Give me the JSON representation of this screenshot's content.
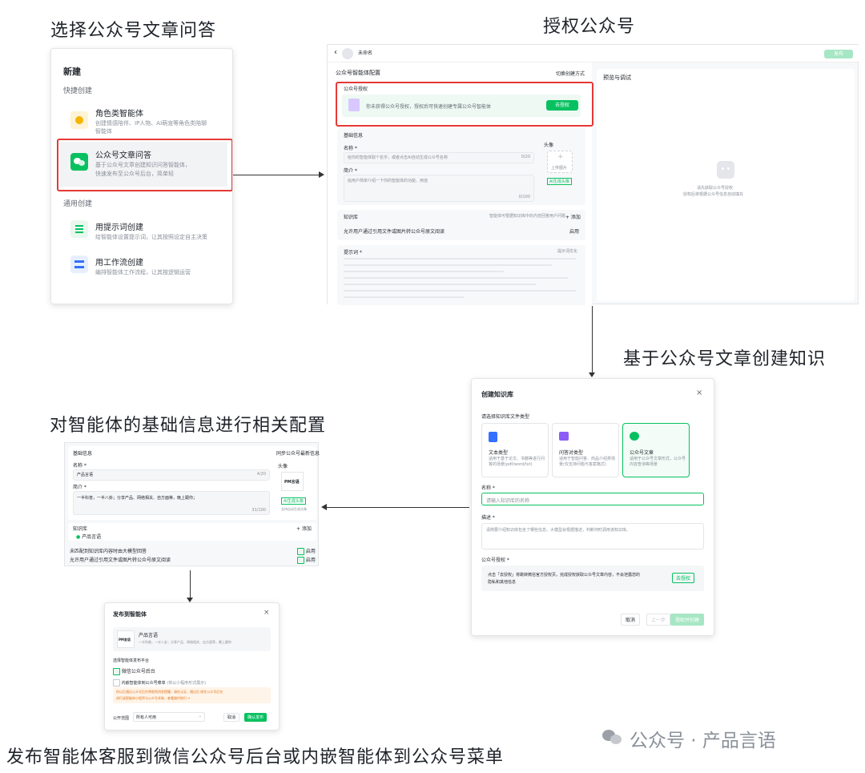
{
  "captions": {
    "step1": "选择公众号文章问答",
    "step2": "授权公众号",
    "step3": "基于公众号文章创建知识",
    "step4": "对智能体的基础信息进行相关配置",
    "step5": "发布智能体客服到微信公众号后台或内嵌智能体到公众号菜单"
  },
  "new_menu": {
    "title": "新建",
    "quick_header": "快捷创建",
    "role": {
      "title": "角色类智能体",
      "desc1": "创建情感陪伴、IP人物、AI萌宠等角色类陪聊",
      "desc2": "智能体"
    },
    "article": {
      "title": "公众号文章问答",
      "desc1": "基于公众号文章创建知识问答智能体，",
      "desc2": "快速发布至公众号后台，简单轻"
    },
    "general_header": "通用创建",
    "prompt": {
      "title": "用提示词创建",
      "desc": "给智能体设置提示词，让其按照设定自主决策"
    },
    "workflow": {
      "title": "用工作流创建",
      "desc": "编排智能体工作流程，让其按逻辑运营"
    }
  },
  "auth_screen": {
    "agent_name": "未命名",
    "publish": "发布",
    "config_title": "公众号智能体配置",
    "switch_mode": "切换创建方式",
    "preview_title": "预览与调试",
    "auth_section": "公众号授权",
    "auth_desc": "你未获得公众号授权，授权后可快速创建专属公众号智能体",
    "auth_btn": "去授权",
    "basic_section": "基础信息",
    "name_label": "名称 *",
    "name_placeholder": "给你的智能体取个名字，或者点击AI自动生成公众号名称",
    "name_count": "0/20",
    "intro_label": "简介 *",
    "intro_placeholder": "给用户简单介绍一下你的智能体的功能、用途",
    "intro_count": "0/100",
    "avatar_label": "头像",
    "avatar_upload": "上传图片",
    "avatar_ai": "AI生成头像",
    "kb_section": "知识库",
    "kb_hint": "智能体可根据知识库中的内容回答用户问题",
    "kb_add": "+ 添加",
    "kb_allow": "允许用户通过引用文件或图片转公众号原文阅读",
    "kb_enable": "启用",
    "prompt_section": "提示词 *",
    "prompt_optimize": "提示词优化",
    "preview_hint1": "请先获取公众号授权",
    "preview_hint2": "授权后将根据公众号信息自动填充"
  },
  "kb_modal": {
    "title": "创建知识库",
    "type_label": "请选择知识库文件类型",
    "types": [
      {
        "name": "文本类型",
        "desc": "适用于基于论文、书籍等进行问答的场景(pdf/word/txt)"
      },
      {
        "name": "问答对类型",
        "desc": "适用于智能问答、商品介绍类场景(仅支持问题与答案格式)"
      },
      {
        "name": "公众号文章",
        "desc": "适用于公众号文章形式，公众号内容查询等场景"
      }
    ],
    "name_label": "名称 *",
    "name_placeholder": "请输入知识库的名称",
    "desc_label": "描述 *",
    "desc_placeholder": "请简要介绍知识库包含了哪些信息，大模型会根据描述，判断何时调用该知识库。",
    "auth_label": "公众号授权 *",
    "auth_text1": "点击「去授权」将跳转微信官方授权页，完成授权获取公众号文章内容，不会泄露您的",
    "auth_text2": "隐私和其他信息",
    "auth_btn": "去授权",
    "cancel": "取消",
    "prev": "上一步",
    "confirm": "授权并创建"
  },
  "basic_config": {
    "section": "基础信息",
    "sync": "同步公众号最新信息",
    "name_label": "名称 *",
    "name_value": "产品言语",
    "name_count": "4/20",
    "intro_label": "简介 *",
    "intro_value": "一半科普，一半八卦；分享产品、网络相关、自方面等，晚上跟你；",
    "intro_count": "31/100",
    "avatar_label": "头像",
    "avatar_text": "PM言语",
    "avatar_ai": "AI生成头像",
    "avatar_hint": "支持自动生成头像",
    "kb_section": "知识库",
    "kb_add": "+ 添加",
    "kb_item": "产品言语",
    "opt1": "未匹配到知识库内容时由大模型回答",
    "opt2": "允许用户通过引用文件或图片转公众号原文阅读",
    "enable1": "启用",
    "enable2": "启用"
  },
  "publish_modal": {
    "title": "发布到智能体",
    "agent_name": "产品言语",
    "agent_desc": "一半科普，一半八卦；分享产品、网络相关、自方面等，晚上跟你",
    "avatar_text": "PM言语",
    "platform_label": "选择智能体发布平台",
    "opt1": "微信公众号后台",
    "opt2": "内嵌智能体到公众号菜单",
    "opt2_hint": "(将以小程序形式展示)",
    "warning1": "你以后通过公众号后台将收到消息提醒，请在认证、通过后 前往公众号后台",
    "warning2": "进行该智能体小程序与公众号关联，查看操作指引 >",
    "scope_label": "公开范围",
    "scope_value": "所有人可用",
    "cancel": "取消",
    "confirm": "确认发布"
  },
  "watermark": "公众号 · 产品言语",
  "colors": {
    "accent": "#07c160",
    "highlight": "#e53935"
  }
}
